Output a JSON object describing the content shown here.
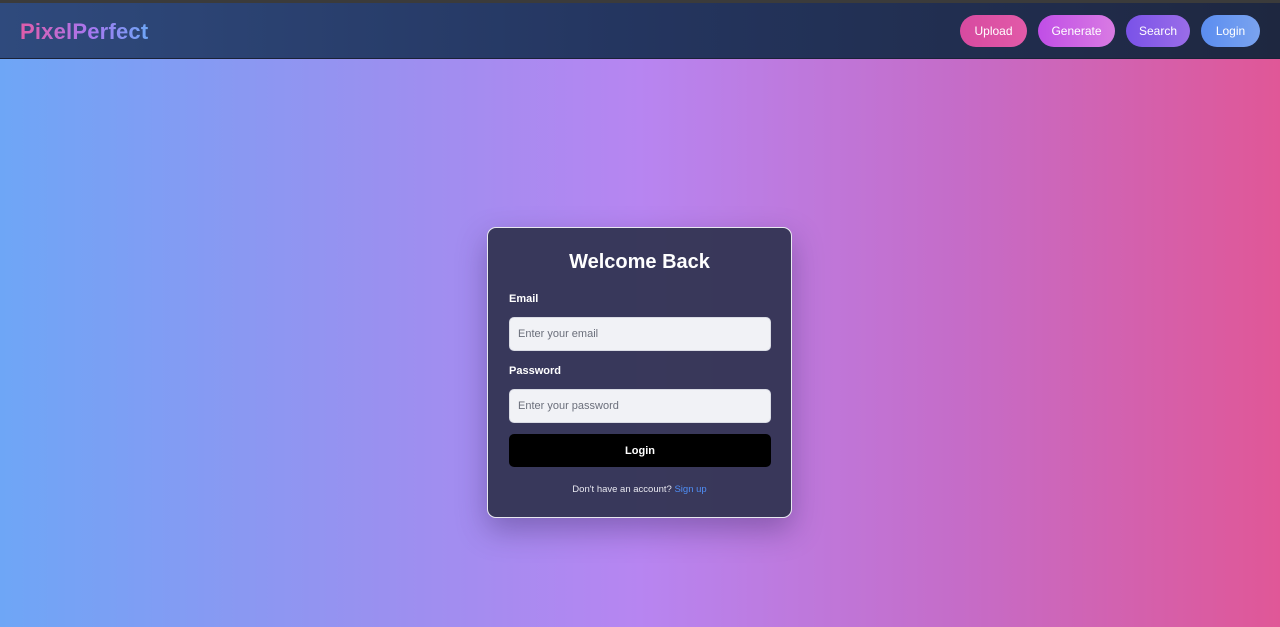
{
  "brand": {
    "name": "PixelPerfect"
  },
  "nav": {
    "upload_label": "Upload",
    "generate_label": "Generate",
    "search_label": "Search",
    "login_label": "Login"
  },
  "login_form": {
    "title": "Welcome Back",
    "email_label": "Email",
    "email_placeholder": "Enter your email",
    "email_value": "",
    "password_label": "Password",
    "password_placeholder": "Enter your password",
    "password_value": "",
    "submit_label": "Login",
    "signup_prompt": "Don't have an account?",
    "signup_link": "Sign up"
  },
  "colors": {
    "background_gradient": [
      "#6ea6f6",
      "#b785f1",
      "#e05797"
    ],
    "navbar": "#24355f",
    "card": "#323452",
    "submit_button": "#000000",
    "link": "#4f8ef5",
    "upload_button": "#d74aa0",
    "generate_button": "#c04ee6",
    "search_button": "#7a52e8",
    "login_button": "#5b8df0"
  }
}
